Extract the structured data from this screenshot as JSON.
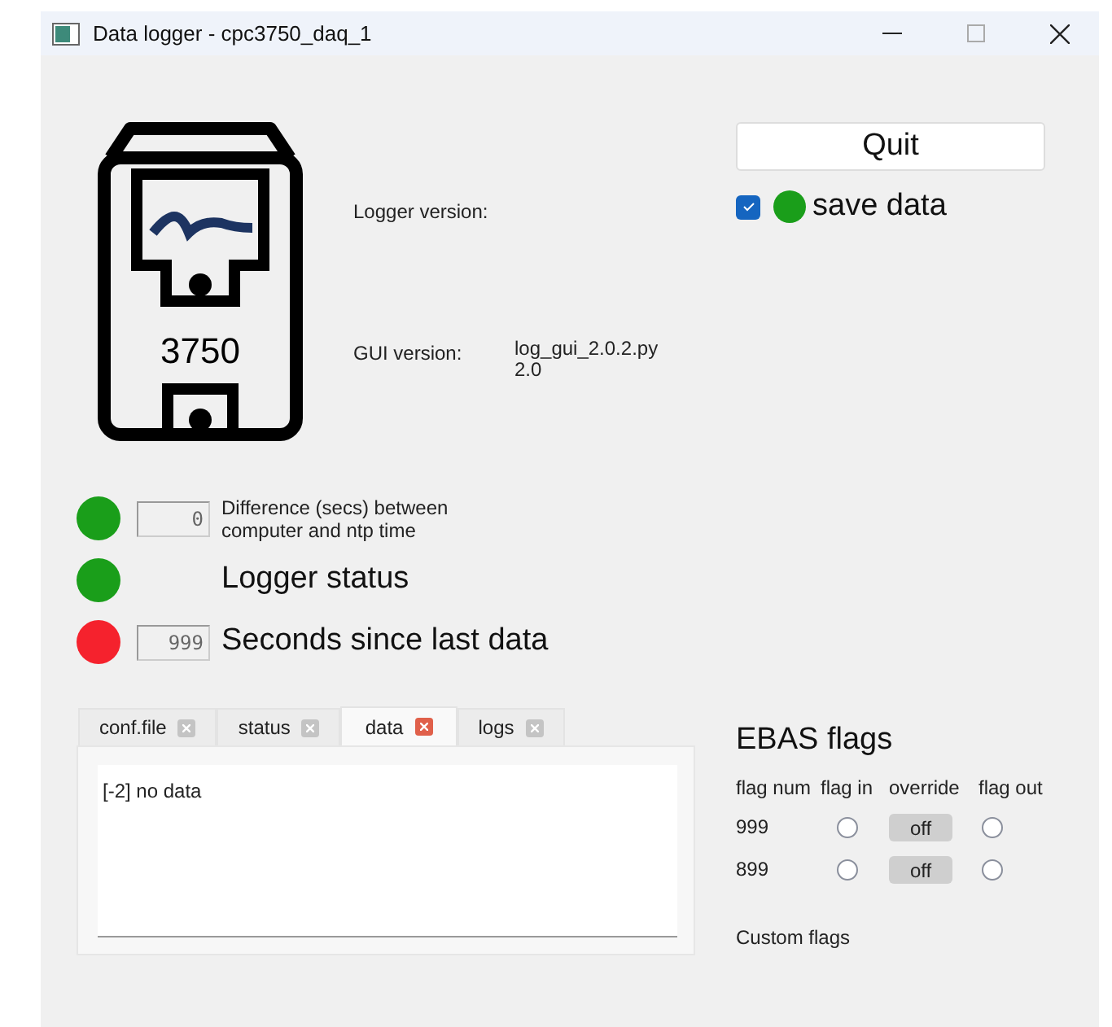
{
  "window": {
    "title": "Data logger - cpc3750_daq_1"
  },
  "device": {
    "model": "3750"
  },
  "versions": {
    "logger_label": "Logger version:",
    "gui_label": "GUI version:",
    "gui_value": [
      "log_gui_2.0.2.py",
      "2.0"
    ]
  },
  "quit_button": "Quit",
  "save_data": {
    "label": "save data",
    "checked": true,
    "color": "#1a9e1a"
  },
  "indicators": [
    {
      "kind": "small",
      "color": "#1a9e1a",
      "display": "0",
      "label": "Difference (secs) between computer and ntp time"
    },
    {
      "kind": "large",
      "color": "#1a9e1a",
      "label": "Logger status"
    },
    {
      "kind": "large",
      "color": "#f5222d",
      "display": "999",
      "label": "Seconds since last data"
    }
  ],
  "tabs": [
    {
      "label": "conf.file",
      "selected": false
    },
    {
      "label": "status",
      "selected": false
    },
    {
      "label": "data",
      "selected": true
    },
    {
      "label": "logs",
      "selected": false
    }
  ],
  "output_text": "[-2] no data",
  "ebas": {
    "title": "EBAS flags",
    "columns": [
      "flag num",
      "flag in",
      "override",
      "flag out"
    ],
    "rows": [
      {
        "num": "999",
        "flag_in": false,
        "override": "off",
        "flag_out": false
      },
      {
        "num": "899",
        "flag_in": false,
        "override": "off",
        "flag_out": false
      }
    ],
    "custom_label": "Custom flags"
  }
}
